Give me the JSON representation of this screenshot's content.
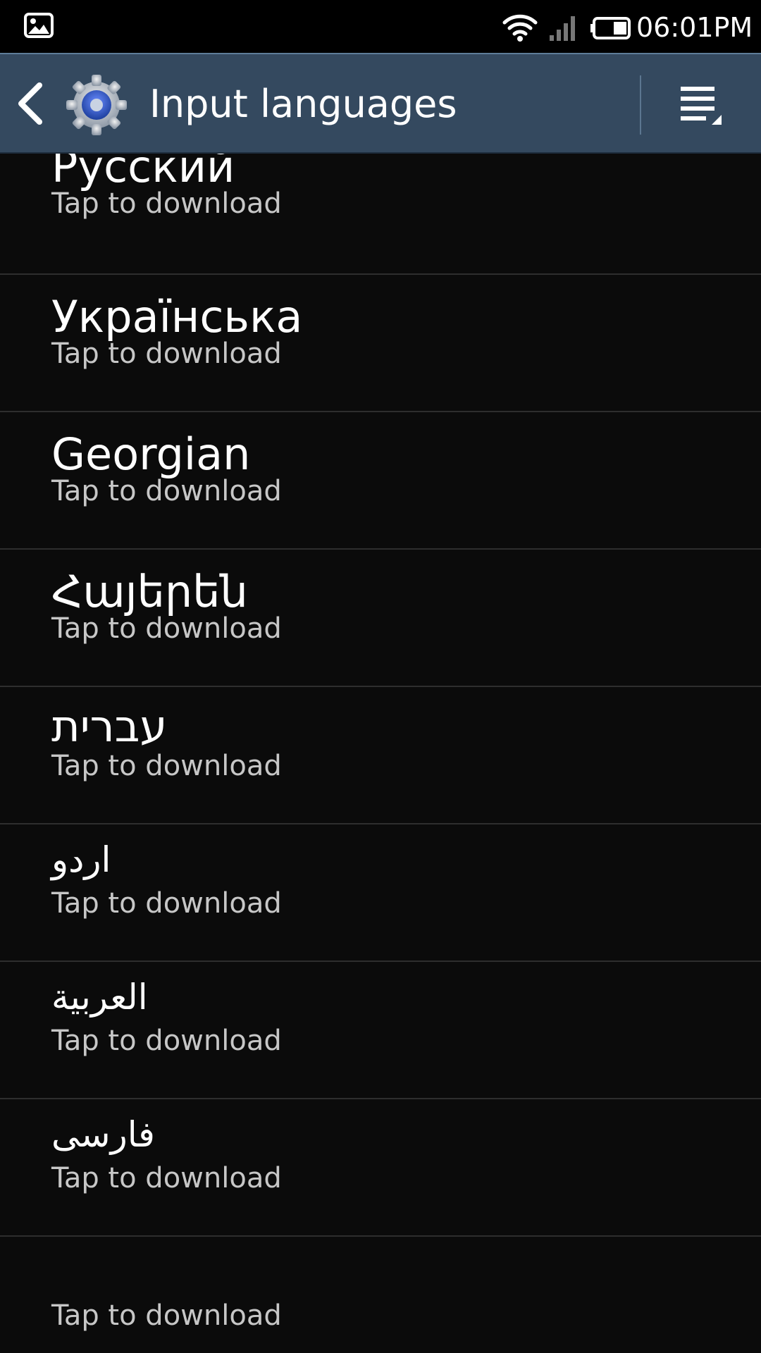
{
  "status_bar": {
    "time": "06:01PM",
    "left_icon": "image-icon",
    "icons": [
      "wifi-icon",
      "signal-icon",
      "battery-icon"
    ]
  },
  "action_bar": {
    "title": "Input languages",
    "back_icon": "chevron-left-icon",
    "app_icon": "settings-gear-icon",
    "menu_icon": "overflow-menu-icon"
  },
  "languages": [
    {
      "name": "Русский",
      "status": "Tap to download"
    },
    {
      "name": "Українська",
      "status": "Tap to download"
    },
    {
      "name": "Georgian",
      "status": "Tap to download"
    },
    {
      "name": "Հայերեն",
      "status": "Tap to download"
    },
    {
      "name": "עברית",
      "status": "Tap to download"
    },
    {
      "name": "اردو",
      "status": "Tap to download"
    },
    {
      "name": "العربية",
      "status": "Tap to download"
    },
    {
      "name": "فارسی",
      "status": "Tap to download"
    },
    {
      "name": "",
      "status": "Tap to download"
    }
  ],
  "colors": {
    "action_bar": "#34495f",
    "background": "#0b0b0b",
    "divider": "#2e2e2e",
    "subtitle": "#c7c7c7"
  }
}
